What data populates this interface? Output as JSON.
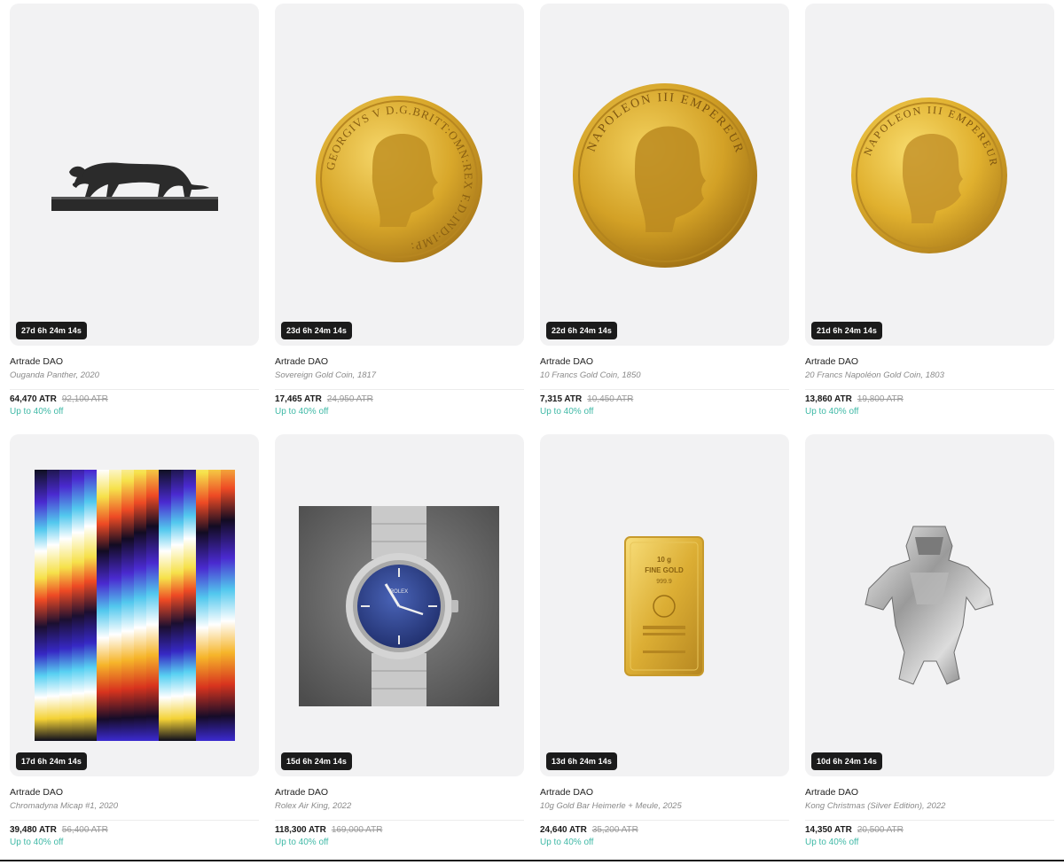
{
  "items": [
    {
      "creator": "Artrade DAO",
      "title": "Ouganda Panther, 2020",
      "timer": "27d 6h 24m 14s",
      "price": "64,470 ATR",
      "old_price": "92,100 ATR",
      "discount": "Up to 40% off",
      "image": "panther-sculpture"
    },
    {
      "creator": "Artrade DAO",
      "title": "Sovereign Gold Coin, 1817",
      "timer": "23d 6h 24m 14s",
      "price": "17,465 ATR",
      "old_price": "24,950 ATR",
      "discount": "Up to 40% off",
      "image": "sovereign-gold-coin",
      "coin_text": "GEORGIVS V D.G.BRITT:OMN:REX F.D.IND:IMP:"
    },
    {
      "creator": "Artrade DAO",
      "title": "10 Francs Gold Coin, 1850",
      "timer": "22d 6h 24m 14s",
      "price": "7,315 ATR",
      "old_price": "10,450 ATR",
      "discount": "Up to 40% off",
      "image": "francs-gold-coin",
      "coin_text": "NAPOLEON III EMPEREUR"
    },
    {
      "creator": "Artrade DAO",
      "title": "20 Francs Napoléon Gold Coin, 1803",
      "timer": "21d 6h 24m 14s",
      "price": "13,860 ATR",
      "old_price": "19,800 ATR",
      "discount": "Up to 40% off",
      "image": "napoleon-gold-coin",
      "coin_text": "NAPOLEON III EMPEREUR"
    },
    {
      "creator": "Artrade DAO",
      "title": "Chromadyna Micap #1, 2020",
      "timer": "17d 6h 24m 14s",
      "price": "39,480 ATR",
      "old_price": "56,400 ATR",
      "discount": "Up to 40% off",
      "image": "chromadyna-artwork"
    },
    {
      "creator": "Artrade DAO",
      "title": "Rolex Air King, 2022",
      "timer": "15d 6h 24m 14s",
      "price": "118,300 ATR",
      "old_price": "169,000 ATR",
      "discount": "Up to 40% off",
      "image": "rolex-watch",
      "watch_text": "ROLEX"
    },
    {
      "creator": "Artrade DAO",
      "title": "10g Gold Bar Heimerle + Meule, 2025",
      "timer": "13d 6h 24m 14s",
      "price": "24,640 ATR",
      "old_price": "35,200 ATR",
      "discount": "Up to 40% off",
      "image": "gold-bar",
      "bar_lines": [
        "10 g",
        "FINE GOLD",
        "999.9"
      ]
    },
    {
      "creator": "Artrade DAO",
      "title": "Kong Christmas (Silver Edition), 2022",
      "timer": "10d 6h 24m 14s",
      "price": "14,350 ATR",
      "old_price": "20,500 ATR",
      "discount": "Up to 40% off",
      "image": "silver-kong-sculpture"
    }
  ],
  "colors": {
    "card_bg": "#f2f2f3",
    "timer_bg": "#1b1b1b",
    "discount": "#3fb9a6",
    "gold": "#d9a92c"
  }
}
